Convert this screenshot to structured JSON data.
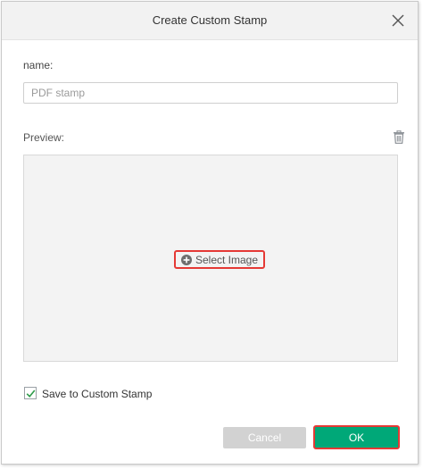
{
  "dialog": {
    "title": "Create Custom Stamp",
    "close_icon": "close-icon"
  },
  "name_field": {
    "label": "name:",
    "value": "",
    "placeholder": "PDF stamp"
  },
  "preview": {
    "label": "Preview:",
    "delete_icon": "trash-icon",
    "select_image_label": "Select Image",
    "select_image_icon": "plus-circle-icon"
  },
  "save_option": {
    "label": "Save to Custom Stamp",
    "checked": true
  },
  "buttons": {
    "cancel_label": "Cancel",
    "ok_label": "OK"
  },
  "colors": {
    "primary": "#00a878",
    "disabled": "#d2d2d2",
    "highlight": "#e53935",
    "checkmark": "#2e9b4a"
  }
}
